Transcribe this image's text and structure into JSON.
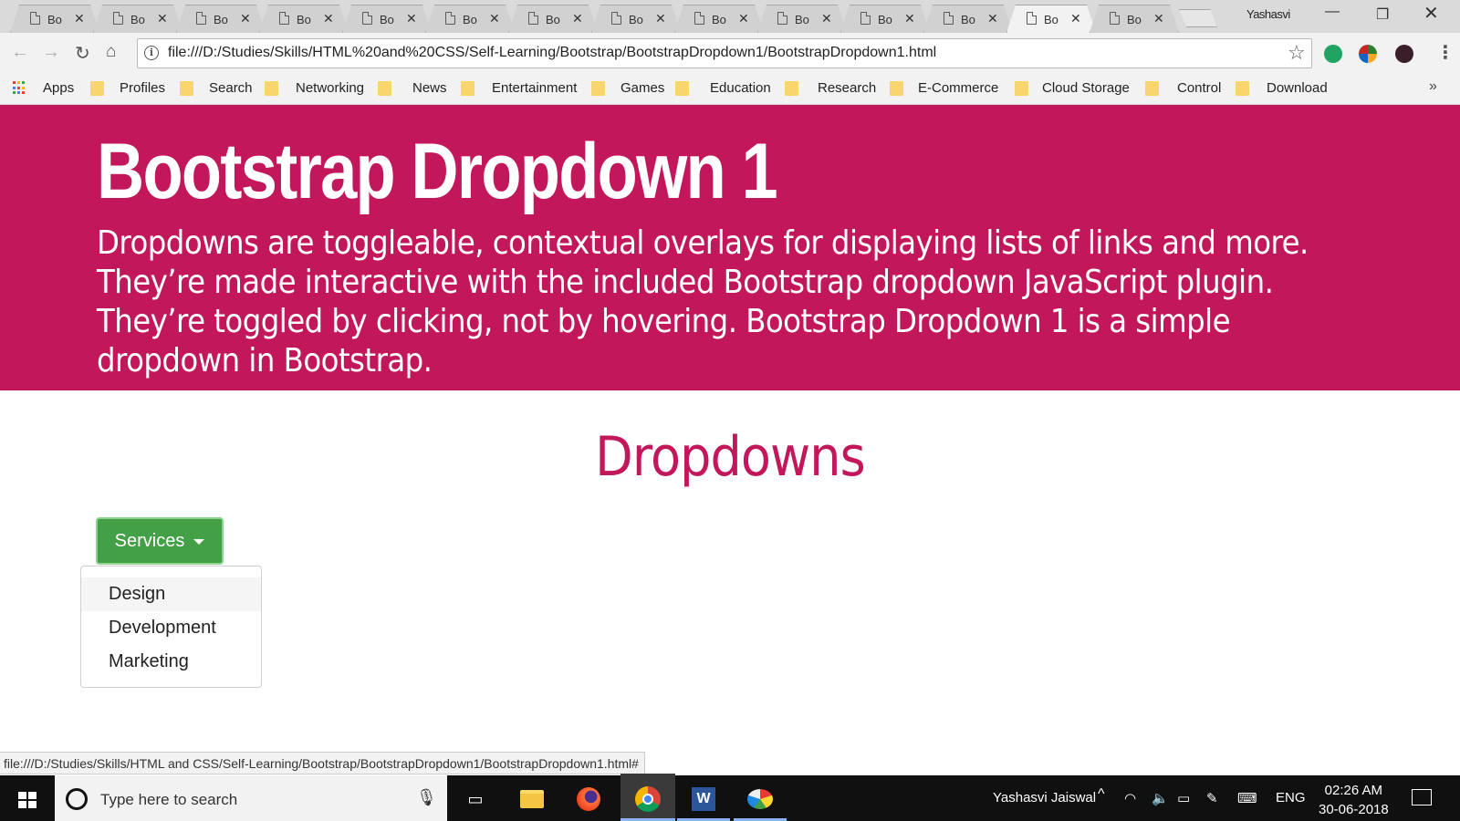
{
  "browser": {
    "tabs": [
      {
        "title": "Bo"
      },
      {
        "title": "Bo"
      },
      {
        "title": "Bo"
      },
      {
        "title": "Bo"
      },
      {
        "title": "Bo"
      },
      {
        "title": "Bo"
      },
      {
        "title": "Bo"
      },
      {
        "title": "Bo"
      },
      {
        "title": "Bo"
      },
      {
        "title": "Bo"
      },
      {
        "title": "Bo"
      },
      {
        "title": "Bo"
      },
      {
        "title": "Bo",
        "active": true
      },
      {
        "title": "Bo"
      }
    ],
    "profile_name": "Yashasvi",
    "url": "file:///D:/Studies/Skills/HTML%20and%20CSS/Self-Learning/Bootstrap/BootstrapDropdown1/BootstrapDropdown1.html",
    "bookmarks": {
      "apps_label": "Apps",
      "folders": [
        "Profiles",
        "Search",
        "Networking",
        "News",
        "Entertainment",
        "Games",
        "Education",
        "Research",
        "E-Commerce",
        "Cloud Storage",
        "Control",
        "Download"
      ]
    },
    "status_url": "file:///D:/Studies/Skills/HTML and CSS/Self-Learning/Bootstrap/BootstrapDropdown1/BootstrapDropdown1.html#"
  },
  "page": {
    "title": "Bootstrap Dropdown 1",
    "description": "Dropdowns are toggleable, contextual overlays for displaying lists of links and more. They’re made interactive with the included Bootstrap dropdown JavaScript plugin. They’re toggled by clicking, not by hovering. Bootstrap Dropdown 1 is a simple dropdown in Bootstrap.",
    "section_title": "Dropdowns",
    "dropdown": {
      "button_label": "Services",
      "items": [
        "Design",
        "Development",
        "Marketing"
      ]
    },
    "colors": {
      "brand": "#c2185b",
      "button": "#43a047"
    }
  },
  "taskbar": {
    "search_placeholder": "Type here to search",
    "user": "Yashasvi Jaiswal",
    "language": "ENG",
    "time": "02:26 AM",
    "date": "30-06-2018"
  }
}
